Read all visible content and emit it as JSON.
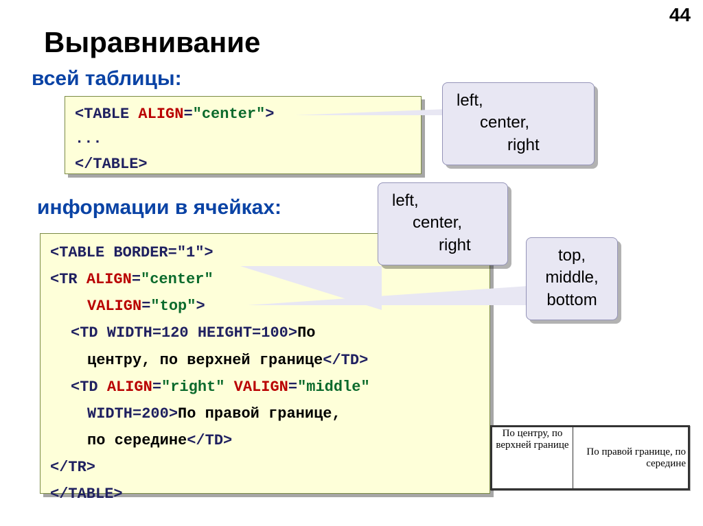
{
  "page_number": "44",
  "title": "Выравнивание",
  "subtitle_table": "всей таблицы:",
  "subtitle_cells": "информации в ячейках:",
  "code1": {
    "l1_open": "<TABLE ",
    "l1_attr": "ALIGN",
    "l1_eq": "=",
    "l1_val": "\"center\"",
    "l1_close": ">",
    "l2": "...",
    "l3": "</TABLE>"
  },
  "code2": {
    "l1": "<TABLE BORDER=\"1\">",
    "l2_a": "<TR ",
    "l2_attr": "ALIGN",
    "l2_b": "=",
    "l2_val": "\"center\"",
    "l3_attr": "VALIGN",
    "l3_b": "=",
    "l3_val": "\"top\"",
    "l3_close": ">",
    "l4_a": "<TD WIDTH=120 HEIGHT=100>",
    "l4_b": "По",
    "l5": "центру, по верхней границе",
    "l5_close": "</TD>",
    "l6_a": "<TD ",
    "l6_attr1": "ALIGN",
    "l6_eq1": "=",
    "l6_val1": "\"right\"",
    "l6_sp": " ",
    "l6_attr2": "VALIGN",
    "l6_eq2": "=",
    "l6_val2": "\"middle\"",
    "l7_a": "WIDTH=200>",
    "l7_b": "По правой границе,",
    "l8": "по середине",
    "l8_close": "</TD>",
    "l9": "</TR>",
    "l10": "</TABLE>"
  },
  "bubble1": {
    "l1": "left,",
    "l2": "center,",
    "l3": "right"
  },
  "bubble2": {
    "l1": "left,",
    "l2": "center,",
    "l3": "right"
  },
  "bubble3": {
    "l1": "top,",
    "l2": "middle,",
    "l3": "bottom"
  },
  "sample": {
    "c1": "По центру, по верхней границе",
    "c2": "По правой границе, по середине"
  }
}
